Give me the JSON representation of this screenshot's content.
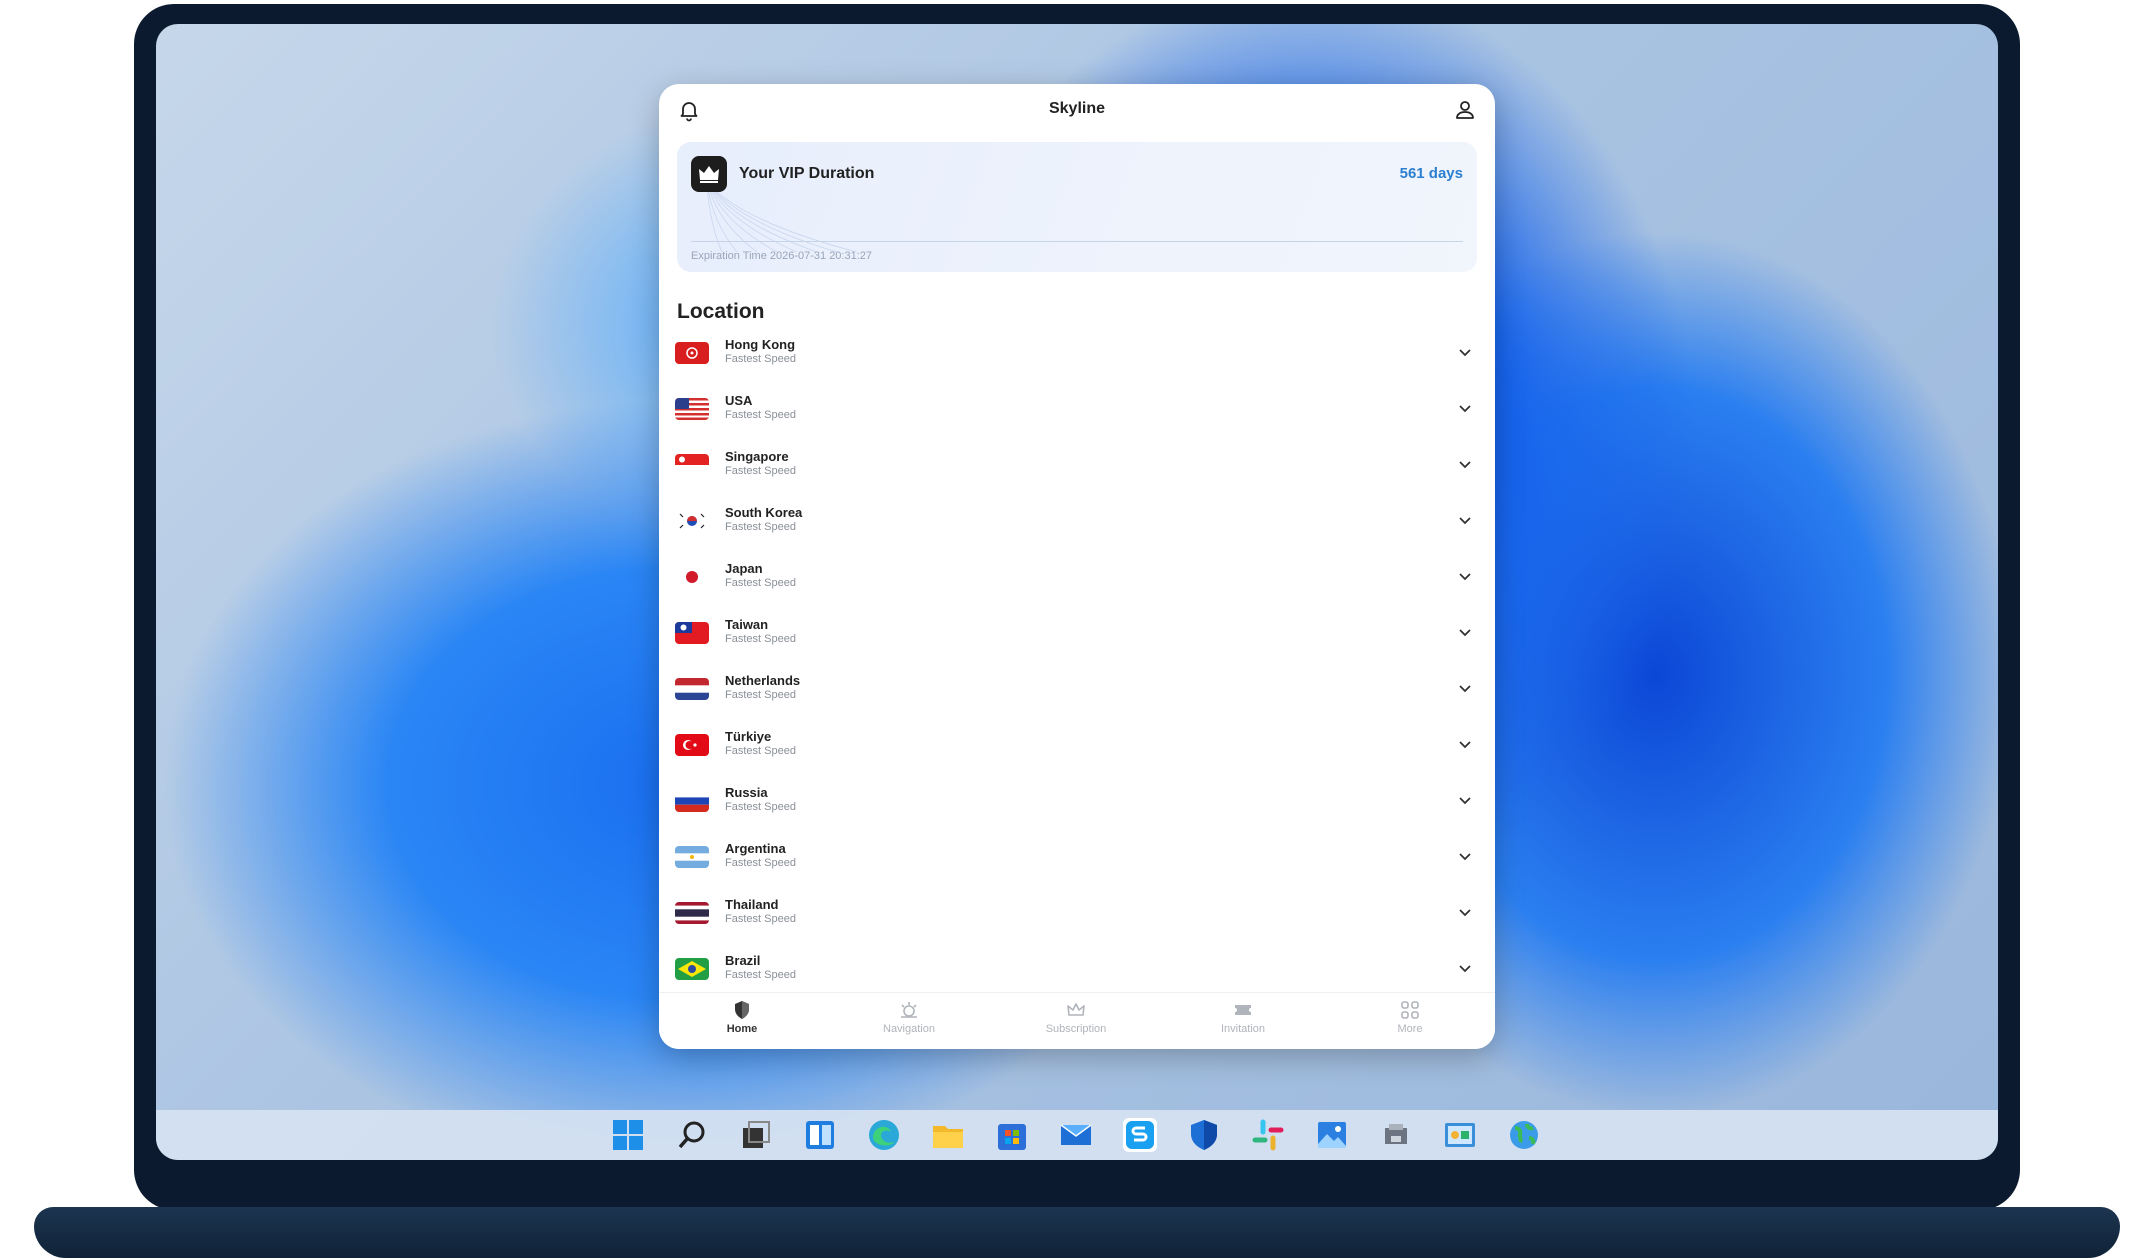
{
  "app": {
    "title": "Skyline",
    "vip": {
      "label": "Your VIP Duration",
      "days": "561 days",
      "expiration": "Expiration Time 2026-07-31 20:31:27"
    },
    "location_title": "Location",
    "locations": [
      {
        "name": "Hong Kong",
        "sub": "Fastest Speed",
        "flag": "hong-kong-flag-icon"
      },
      {
        "name": "USA",
        "sub": "Fastest Speed",
        "flag": "usa-flag-icon"
      },
      {
        "name": "Singapore",
        "sub": "Fastest Speed",
        "flag": "singapore-flag-icon"
      },
      {
        "name": "South Korea",
        "sub": "Fastest Speed",
        "flag": "south-korea-flag-icon"
      },
      {
        "name": "Japan",
        "sub": "Fastest Speed",
        "flag": "japan-flag-icon"
      },
      {
        "name": "Taiwan",
        "sub": "Fastest Speed",
        "flag": "taiwan-flag-icon"
      },
      {
        "name": "Netherlands",
        "sub": "Fastest Speed",
        "flag": "netherlands-flag-icon"
      },
      {
        "name": "Türkiye",
        "sub": "Fastest Speed",
        "flag": "turkiye-flag-icon"
      },
      {
        "name": "Russia",
        "sub": "Fastest Speed",
        "flag": "russia-flag-icon"
      },
      {
        "name": "Argentina",
        "sub": "Fastest Speed",
        "flag": "argentina-flag-icon"
      },
      {
        "name": "Thailand",
        "sub": "Fastest Speed",
        "flag": "thailand-flag-icon"
      },
      {
        "name": "Brazil",
        "sub": "Fastest Speed",
        "flag": "brazil-flag-icon"
      }
    ],
    "nav": [
      {
        "label": "Home",
        "icon": "shield-icon",
        "active": true
      },
      {
        "label": "Navigation",
        "icon": "navigation-icon",
        "active": false
      },
      {
        "label": "Subscription",
        "icon": "crown-icon",
        "active": false
      },
      {
        "label": "Invitation",
        "icon": "ticket-icon",
        "active": false
      },
      {
        "label": "More",
        "icon": "grid-icon",
        "active": false
      }
    ]
  },
  "taskbar": {
    "icons": [
      "start-icon",
      "search-icon",
      "task-view-icon",
      "widgets-icon",
      "edge-icon",
      "file-explorer-icon",
      "store-icon",
      "mail-icon",
      "skyline-app-icon",
      "defender-icon",
      "slack-icon",
      "photos-icon",
      "device-icon",
      "control-panel-icon",
      "globe-icon"
    ]
  },
  "colors": {
    "accent": "#2a7fd1",
    "frame": "#0b1a2e"
  }
}
